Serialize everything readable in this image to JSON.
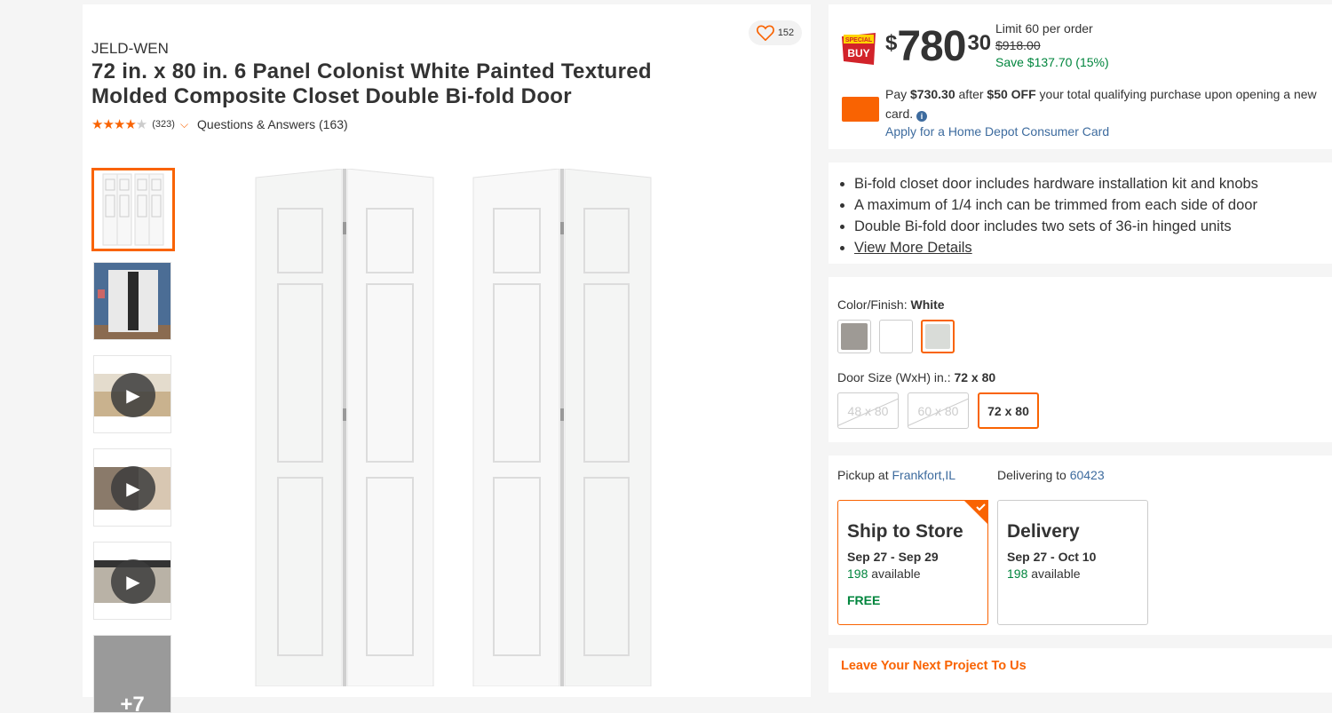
{
  "product": {
    "brand": "JELD-WEN",
    "title": "72 in. x 80 in. 6 Panel Colonist White Painted Textured Molded Composite Closet Double Bi-fold Door",
    "rating": 4.5,
    "review_count": "(323)",
    "qa_label": "Questions & Answers (163)",
    "favorites_count": "152"
  },
  "thumbnails": {
    "more_label": "+7"
  },
  "pricing": {
    "badge_line1": "SPECIAL",
    "badge_line2": "BUY",
    "dollar_sign": "$",
    "price_whole": "780",
    "price_cents": "30",
    "limit": "Limit 60 per order",
    "was_price": "$918.00",
    "save": "Save $137.70 (15%)",
    "pay_prefix": "Pay ",
    "pay_amount": "$730.30",
    "pay_after": " after ",
    "pay_off": "$50 OFF",
    "pay_rest": " your total qualifying purchase upon opening a new card.",
    "apply_link": "Apply for a Home Depot Consumer Card"
  },
  "highlights": {
    "items": [
      "Bi-fold closet door includes hardware installation kit and knobs",
      "A maximum of 1/4 inch can be trimmed from each side of door",
      "Double Bi-fold door includes two sets of 36-in hinged units"
    ],
    "view_more": "View More Details"
  },
  "options": {
    "color_label": "Color/Finish",
    "color_value": "White",
    "colors": [
      "#9e9a95",
      "#ffffff",
      "#d9dcd8"
    ],
    "size_label": "Door Size (WxH) in.",
    "size_value": "72 x 80",
    "sizes": [
      "48 x 80",
      "60 x 80",
      "72 x 80"
    ]
  },
  "fulfillment": {
    "pickup_label": "Pickup at ",
    "pickup_store": "Frankfort,IL",
    "deliver_label": "Delivering to ",
    "deliver_zip": "60423",
    "ship": {
      "title": "Ship to Store",
      "dates": "Sep 27 - Sep 29",
      "count": "198",
      "avail": " available",
      "price": "FREE"
    },
    "delivery": {
      "title": "Delivery",
      "dates": "Sep 27 - Oct 10",
      "count": "198",
      "avail": " available"
    }
  },
  "feedback": {
    "label": "Leave Your Next Project To Us"
  },
  "colors": {
    "accent": "#f96302",
    "link": "#3d6b9e",
    "success": "#00853d"
  }
}
